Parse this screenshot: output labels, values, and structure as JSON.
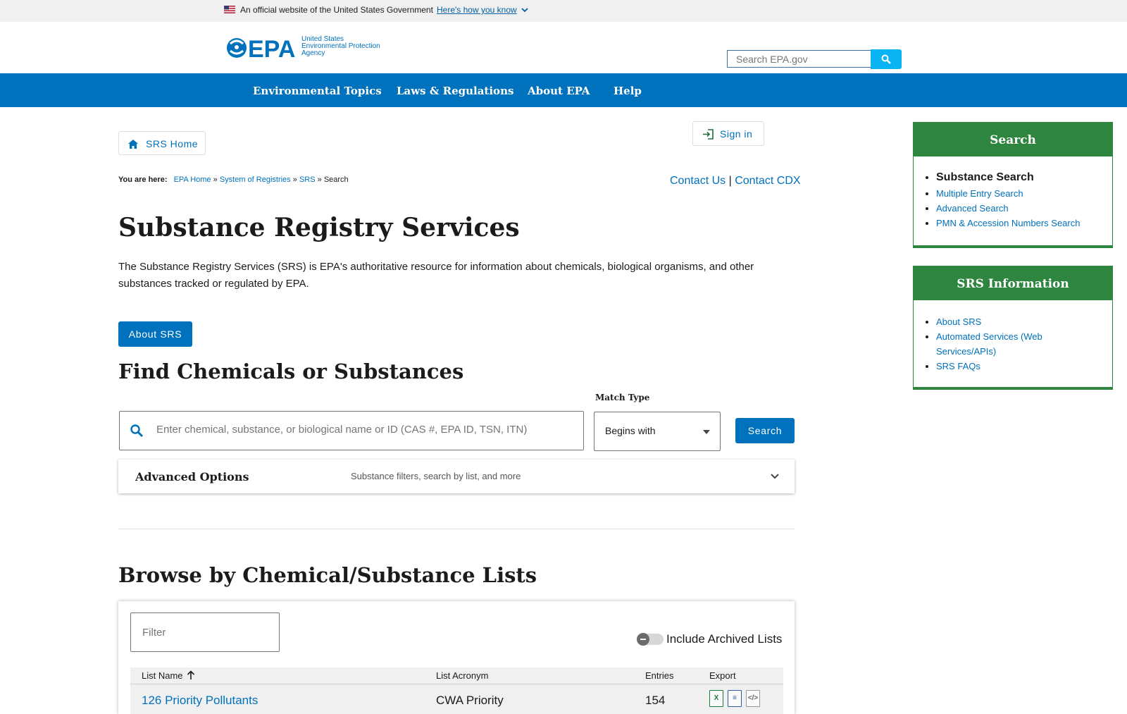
{
  "gov_banner": {
    "text": "An official website of the United States Government",
    "link": "Here's how you know"
  },
  "header": {
    "agency_lines": [
      "United States",
      "Environmental Protection",
      "Agency"
    ],
    "search_placeholder": "Search EPA.gov"
  },
  "nav": {
    "items": [
      "Environmental Topics",
      "Laws & Regulations",
      "About EPA",
      "Help"
    ]
  },
  "buttons": {
    "srs_home": "SRS Home",
    "sign_in": "Sign in",
    "about_srs": "About SRS",
    "search": "Search"
  },
  "breadcrumb": {
    "label": "You are here:",
    "items": [
      "EPA Home",
      "System of Registries",
      "SRS",
      "Search"
    ],
    "sep": "»"
  },
  "contact": {
    "us": "Contact Us",
    "sep": "|",
    "cdx": "Contact CDX"
  },
  "page_title": "Substance Registry Services",
  "intro": "The Substance Registry Services (SRS) is EPA's authoritative resource for information about chemicals, biological organisms, and other substances tracked or regulated by EPA.",
  "find": {
    "heading": "Find Chemicals or Substances",
    "placeholder": "Enter chemical, substance, or biological name or ID (CAS #, EPA ID, TSN, ITN)",
    "match_label": "Match Type",
    "match_value": "Begins with"
  },
  "advanced": {
    "title": "Advanced Options",
    "desc": "Substance filters, search by list, and more"
  },
  "browse": {
    "heading": "Browse by Chemical/Substance Lists",
    "filter_placeholder": "Filter",
    "toggle_label": "Include Archived Lists",
    "columns": [
      "List Name",
      "List Acronym",
      "Entries",
      "Export"
    ],
    "rows": [
      {
        "name": "126 Priority Pollutants",
        "acronym": "CWA Priority",
        "entries": "154"
      }
    ]
  },
  "sidebar": {
    "search_box": {
      "title": "Search",
      "items": [
        "Substance Search",
        "Multiple Entry Search",
        "Advanced Search",
        "PMN & Accession Numbers Search"
      ]
    },
    "info_box": {
      "title": "SRS Information",
      "items": [
        "About SRS",
        "Automated Services (Web Services/APIs)",
        "SRS FAQs"
      ]
    }
  },
  "colors": {
    "epa_blue": "#0071bc",
    "sidebar_green": "#2e8540",
    "search_button": "#0ab3f2"
  }
}
